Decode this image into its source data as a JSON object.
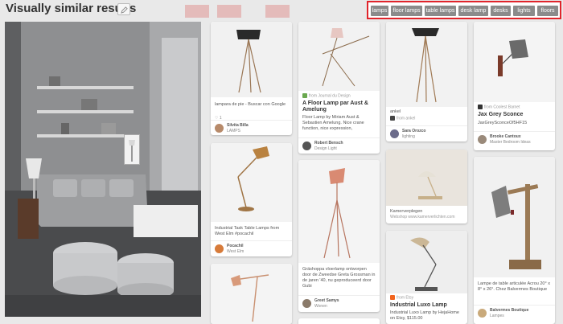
{
  "header": {
    "title": "Visually similar results"
  },
  "filters": [
    "lamps",
    "floor lamps",
    "table lamps",
    "desk lamp",
    "desks",
    "lights",
    "floors"
  ],
  "colors": {
    "accent_red": "#e0242b",
    "pill_gray": "#8b8b8b"
  },
  "pins": {
    "p1": {
      "desc": "lampara de pie - Buscar con Google",
      "stats": "1",
      "name": "Silvita Billa",
      "board": "LAMPS"
    },
    "p2": {
      "desc": "Industrial Task Table Lamps from West Elm #pocachil",
      "name": "Pocachil",
      "board": "West Elm"
    },
    "p4": {
      "source": "from Journal du Design",
      "title": "A Floor Lamp par Aust & Amelung",
      "desc": "Floor Lamp by Miriam Aust & Sebastien Amelung. Nice crane function, nice expression,",
      "name": "Robert Bensch",
      "board": "Design Light"
    },
    "p5": {
      "desc": "Gräshoppa vloerlamp ontworpen door de Zweedse Greta Grossman in de jaren '40, nu geproduceerd door Gubi",
      "name": "Greet Samys",
      "board": "Wonen"
    },
    "p6": {
      "desc": "ankel",
      "source": "from ankel",
      "name": "Sara Orozco",
      "board": "lighting"
    },
    "p7": {
      "desc": "Kamerverplegen",
      "source": "Webshop www.kamerverlichten.com"
    },
    "p8": {
      "source": "from Etsy",
      "title": "Industrial Luxo Lamp",
      "desc": "Industrial Luxo Lamp by HejaHome on Etsy, $115.00"
    },
    "p9": {
      "source": "from Coolest Barnet",
      "title": "Jax Grey Sconce",
      "desc": "JaxGreySconceOf5HF15",
      "name": "Brooke Cantoux",
      "board": "Master Bedroom Ideas"
    },
    "p10": {
      "desc": "Lampe de table articulée Acrou 20° x 8° x 26°. Chez Balvermes Boutique",
      "name": "Balvermes Boutique",
      "board": "Lampes"
    }
  }
}
